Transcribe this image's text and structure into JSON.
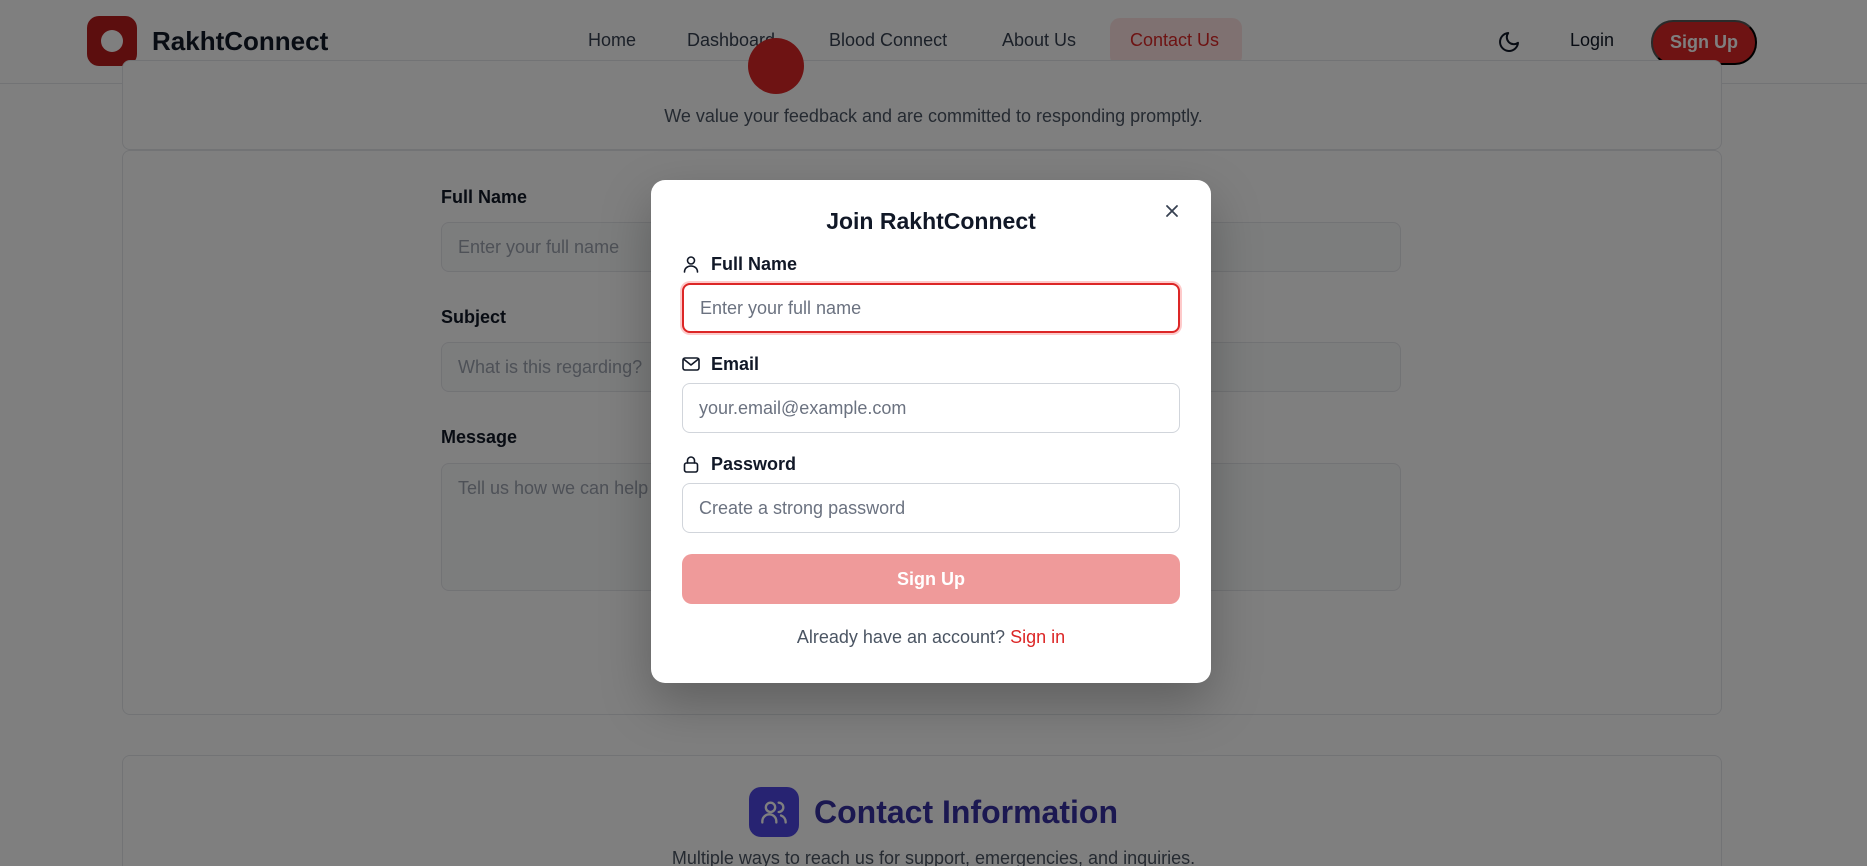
{
  "nav": {
    "brand": "RakhtConnect",
    "links": [
      "Home",
      "Dashboard",
      "Blood Connect",
      "About Us",
      "Contact Us"
    ],
    "active_link": "Contact Us",
    "login": "Login",
    "signup": "Sign Up"
  },
  "page": {
    "hero_subtitle": "We value your feedback and are committed to responding promptly.",
    "form": {
      "full_name_label": "Full Name",
      "full_name_placeholder": "Enter your full name",
      "subject_label": "Subject",
      "subject_placeholder": "What is this regarding?",
      "message_label": "Message",
      "message_placeholder": "Tell us how we can help you..."
    },
    "contact_title": "Contact Information",
    "contact_subtitle": "Multiple ways to reach us for support, emergencies, and inquiries."
  },
  "modal": {
    "title": "Join RakhtConnect",
    "full_name_label": "Full Name",
    "full_name_placeholder": "Enter your full name",
    "email_label": "Email",
    "email_placeholder": "your.email@example.com",
    "password_label": "Password",
    "password_placeholder": "Create a strong password",
    "submit_label": "Sign Up",
    "switch_text": "Already have an account?",
    "switch_link": "Sign in"
  },
  "colors": {
    "brand_red": "#dc2626",
    "submit_disabled": "#ef9a9a",
    "contact_indigo": "#4f46e5"
  }
}
